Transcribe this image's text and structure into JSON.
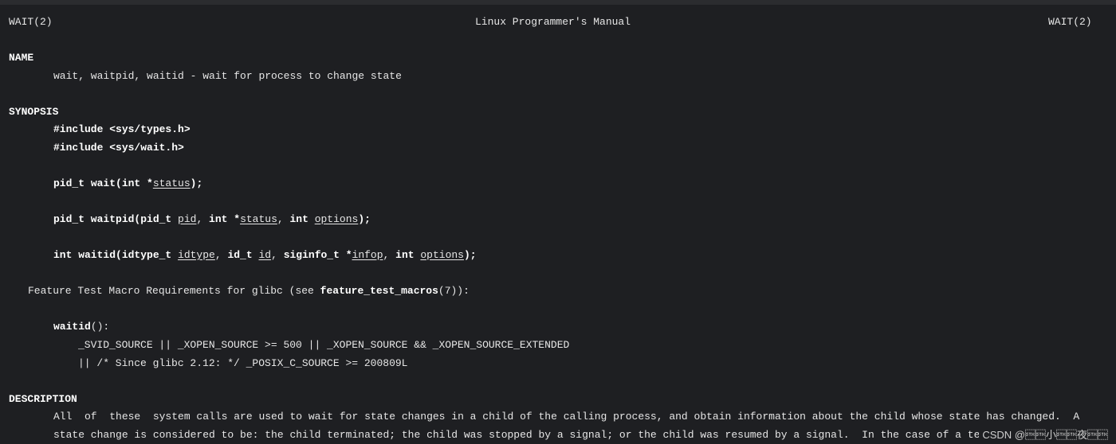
{
  "header": {
    "left": "WAIT(2)",
    "center": "Linux Programmer's Manual",
    "right": "WAIT(2)"
  },
  "name": {
    "heading": "NAME",
    "text": "wait, waitpid, waitid - wait for process to change state"
  },
  "synopsis": {
    "heading": "SYNOPSIS",
    "include1": "#include <sys/types.h>",
    "include2": "#include <sys/wait.h>",
    "wait": {
      "ret": "pid_t ",
      "fn": "wait(int *",
      "arg1": "status",
      "end": ");"
    },
    "waitpid": {
      "p1": "pid_t waitpid(pid_t ",
      "a1": "pid",
      "s1": ", ",
      "p2": "int *",
      "a2": "status",
      "s2": ", ",
      "p3": "int ",
      "a3": "options",
      "end": ");"
    },
    "waitid": {
      "p1": "int waitid(idtype_t ",
      "a1": "idtype",
      "s1": ", ",
      "p2": "id_t ",
      "a2": "id",
      "s2": ", ",
      "p3": "siginfo_t *",
      "a3": "infop",
      "s3": ", ",
      "p4": "int ",
      "a4": "options",
      "end": ");"
    },
    "ftm_pre": "Feature Test Macro Requirements for glibc (see ",
    "ftm_bold": "feature_test_macros",
    "ftm_post": "(7)):",
    "waitid_fn": "waitid",
    "waitid_paren": "():",
    "cond1": "_SVID_SOURCE || _XOPEN_SOURCE >= 500 || _XOPEN_SOURCE && _XOPEN_SOURCE_EXTENDED",
    "cond2": "|| /* Since glibc 2.12: */ _POSIX_C_SOURCE >= 200809L"
  },
  "description": {
    "heading": "DESCRIPTION",
    "line1": "All  of  these  system calls are used to wait for state changes in a child of the calling process, and obtain information about the child whose state has changed.  A",
    "line2": "state change is considered to be: the child terminated; the child was stopped by a signal; or the child was resumed by a signal.  In the case of a terminated  child,"
  },
  "watermark": "CSDN @\u0002\u0002小\u0002\u0002夜\u0002\u0002"
}
